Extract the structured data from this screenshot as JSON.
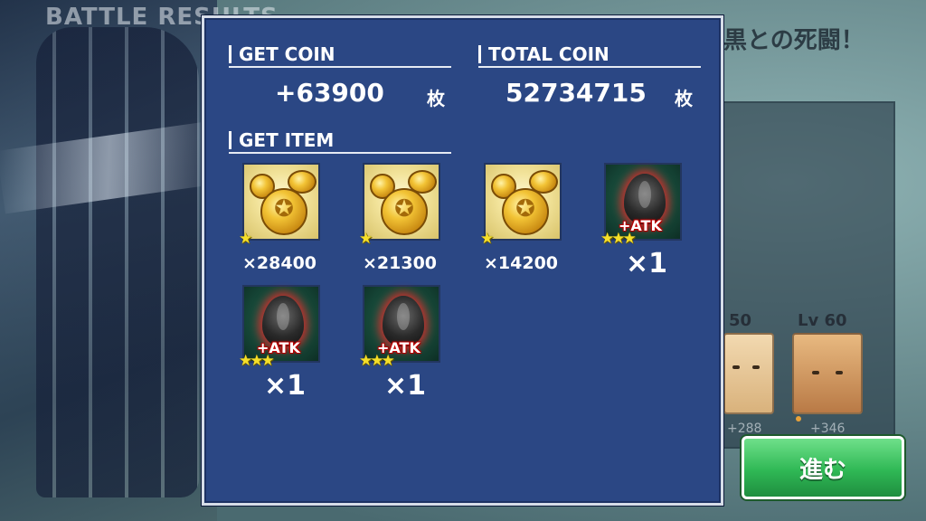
{
  "background": {
    "title": "BATTLE RESULTS",
    "stage_title": "黒との死闘！",
    "characters": [
      {
        "level": "50",
        "exp": "+288"
      },
      {
        "level_prefix": "Lv",
        "level": "60",
        "exp": "+346"
      }
    ]
  },
  "dialog": {
    "get_coin": {
      "label": "GET COIN",
      "value": "+63900",
      "unit": "枚"
    },
    "total_coin": {
      "label": "TOTAL COIN",
      "value": "52734715",
      "unit": "枚"
    },
    "get_item": {
      "label": "GET ITEM",
      "items": [
        {
          "kind": "coin",
          "stars": 1,
          "quantity": "×28400"
        },
        {
          "kind": "coin",
          "stars": 1,
          "quantity": "×21300"
        },
        {
          "kind": "coin",
          "stars": 1,
          "quantity": "×14200"
        },
        {
          "kind": "atk-seed",
          "badge": "+ATK",
          "stars": 3,
          "quantity": "×1"
        },
        {
          "kind": "atk-seed",
          "badge": "+ATK",
          "stars": 3,
          "quantity": "×1"
        },
        {
          "kind": "atk-seed",
          "badge": "+ATK",
          "stars": 3,
          "quantity": "×1"
        }
      ]
    }
  },
  "proceed_button": {
    "label": "進む"
  },
  "icons": {
    "star": "star-icon",
    "coin": "coin-icon",
    "atk_seed": "atk-seed-icon"
  },
  "colors": {
    "dialog_bg": "#2b4784",
    "button_green": "#2fb855",
    "star_yellow": "#f5df2a"
  }
}
